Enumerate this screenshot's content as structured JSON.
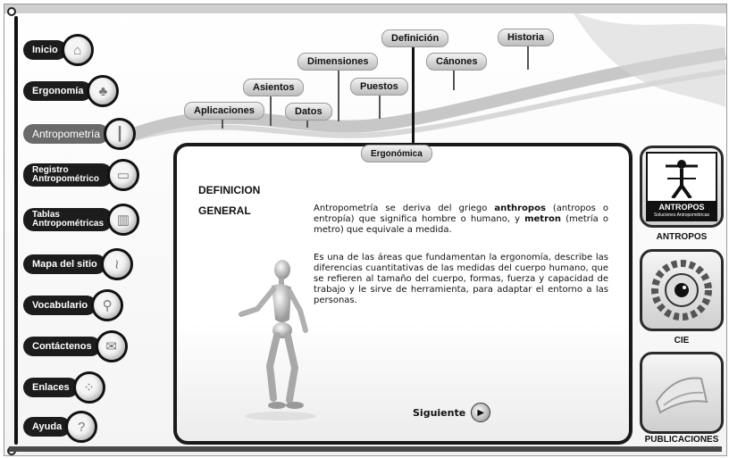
{
  "left_nav": [
    {
      "label": "Inicio",
      "icon": "house-icon",
      "glyph": "⌂"
    },
    {
      "label": "Ergonomía",
      "icon": "runner-icon",
      "glyph": "♣"
    },
    {
      "label": "Antropometría",
      "icon": "ruler-figure-icon",
      "glyph": "┃",
      "active": true
    },
    {
      "label": "Registro Antropométrico",
      "icon": "mouse-icon",
      "glyph": "▭"
    },
    {
      "label": "Tablas Antropométricas",
      "icon": "bar-chart-icon",
      "glyph": "▥"
    },
    {
      "label": "Mapa del sitio",
      "icon": "map-icon",
      "glyph": "≀"
    },
    {
      "label": "Vocabulario",
      "icon": "magnifier-icon",
      "glyph": "⚲"
    },
    {
      "label": "Contáctenos",
      "icon": "envelope-icon",
      "glyph": "✉"
    },
    {
      "label": "Enlaces",
      "icon": "network-icon",
      "glyph": "⁘"
    },
    {
      "label": "Ayuda",
      "icon": "question-icon",
      "glyph": "?"
    }
  ],
  "top_tabs": {
    "aplicaciones": "Aplicaciones",
    "asientos": "Asientos",
    "datos": "Datos",
    "dimensiones": "Dimensiones",
    "puestos": "Puestos",
    "definicion": "Definición",
    "canones": "Cánones",
    "historia": "Historia"
  },
  "content": {
    "tab": "Ergonómica",
    "heading1": "DEFINICION",
    "heading2": "GENERAL",
    "p1_a": "Antropometría se deriva del griego ",
    "p1_b": "anthropos",
    "p1_c": " (antropos o entropía) que significa hombre o humano, y ",
    "p1_d": "metron",
    "p1_e": " (metría o metro) que equivale a medida.",
    "p2": "Es una de las áreas que fundamentan la ergonomía, describe las diferencias cuantitativas de las medidas del cuerpo humano, que se refieren al tamaño del cuerpo, formas, fuerza y capacidad de trabajo y le sirve de herramienta, para adaptar el entorno a las personas.",
    "next_label": "Siguiente"
  },
  "right_sidebar": {
    "antropos_logo": "ANTROPOS",
    "antropos_logo_sub": "Soluciones Antropométricas",
    "antropos_label": "ANTROPOS",
    "cie_label": "CIE",
    "publicaciones_label": "PUBLICACIONES"
  }
}
